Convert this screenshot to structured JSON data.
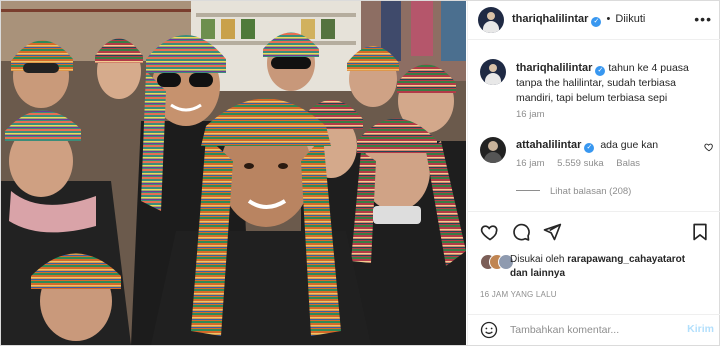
{
  "colors": {
    "accent": "#3897f0",
    "muted_text": "#8e8e8e",
    "post_button_disabled": "#b2dffc",
    "border": "#dbdbdb"
  },
  "header": {
    "username": "thariqhalilintar",
    "separator": "•",
    "follow_status": "Diikuti",
    "more_icon": "more-horizontal-icon"
  },
  "caption": {
    "username": "thariqhalilintar",
    "text": "tahun ke 4 puasa tanpa the halilintar, sudah terbiasa mandiri, tapi belum terbiasa sepi",
    "time": "16 jam"
  },
  "comment": {
    "username": "attahalilintar",
    "text": "ada gue kan",
    "time": "16 jam",
    "likes": "5.559 suka",
    "reply_label": "Balas",
    "view_replies": "Lihat balasan (208)"
  },
  "actions": {
    "icons": [
      "heart-icon",
      "comment-icon",
      "share-icon",
      "bookmark-icon"
    ]
  },
  "likes": {
    "prefix": "Disukai oleh",
    "user": "rarapawang_cahayatarot",
    "suffix": "dan lainnya"
  },
  "date": "16 JAM YANG LALU",
  "comment_box": {
    "placeholder": "Tambahkan komentar...",
    "post_label": "Kirim"
  }
}
